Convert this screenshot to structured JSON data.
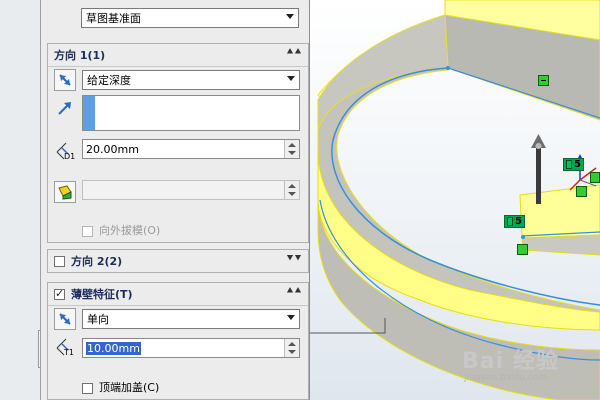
{
  "panel": {
    "top_combo": {
      "value": "草图基准面"
    },
    "direction1": {
      "title": "方向 1(1)",
      "end_condition": "给定深度",
      "depth_label": "D1",
      "depth_value": "20.00mm",
      "draft_outward_label": "向外拔模(O)"
    },
    "direction2": {
      "title": "方向 2(2)",
      "checked": false
    },
    "thin_feature": {
      "title": "薄壁特征(T)",
      "checked": true,
      "type": "单向",
      "thickness_label": "T1",
      "thickness_value": "10.00mm",
      "cap_ends_label": "顶端加盖(C)"
    }
  },
  "viewport": {
    "dim_tags": [
      "5",
      "5",
      "5"
    ],
    "accent": "#ffff66",
    "edge_color": "#3a8fd8"
  },
  "watermark": {
    "brand": "Bai 经验",
    "url": "jingyan.baidu.com"
  },
  "icons": [
    "collapse-up-icon",
    "expand-down-icon",
    "reverse-direction-icon",
    "direction-arrow-icon",
    "depth-dimension-icon",
    "draft-icon",
    "thickness-dimension-icon",
    "triad-icon"
  ]
}
